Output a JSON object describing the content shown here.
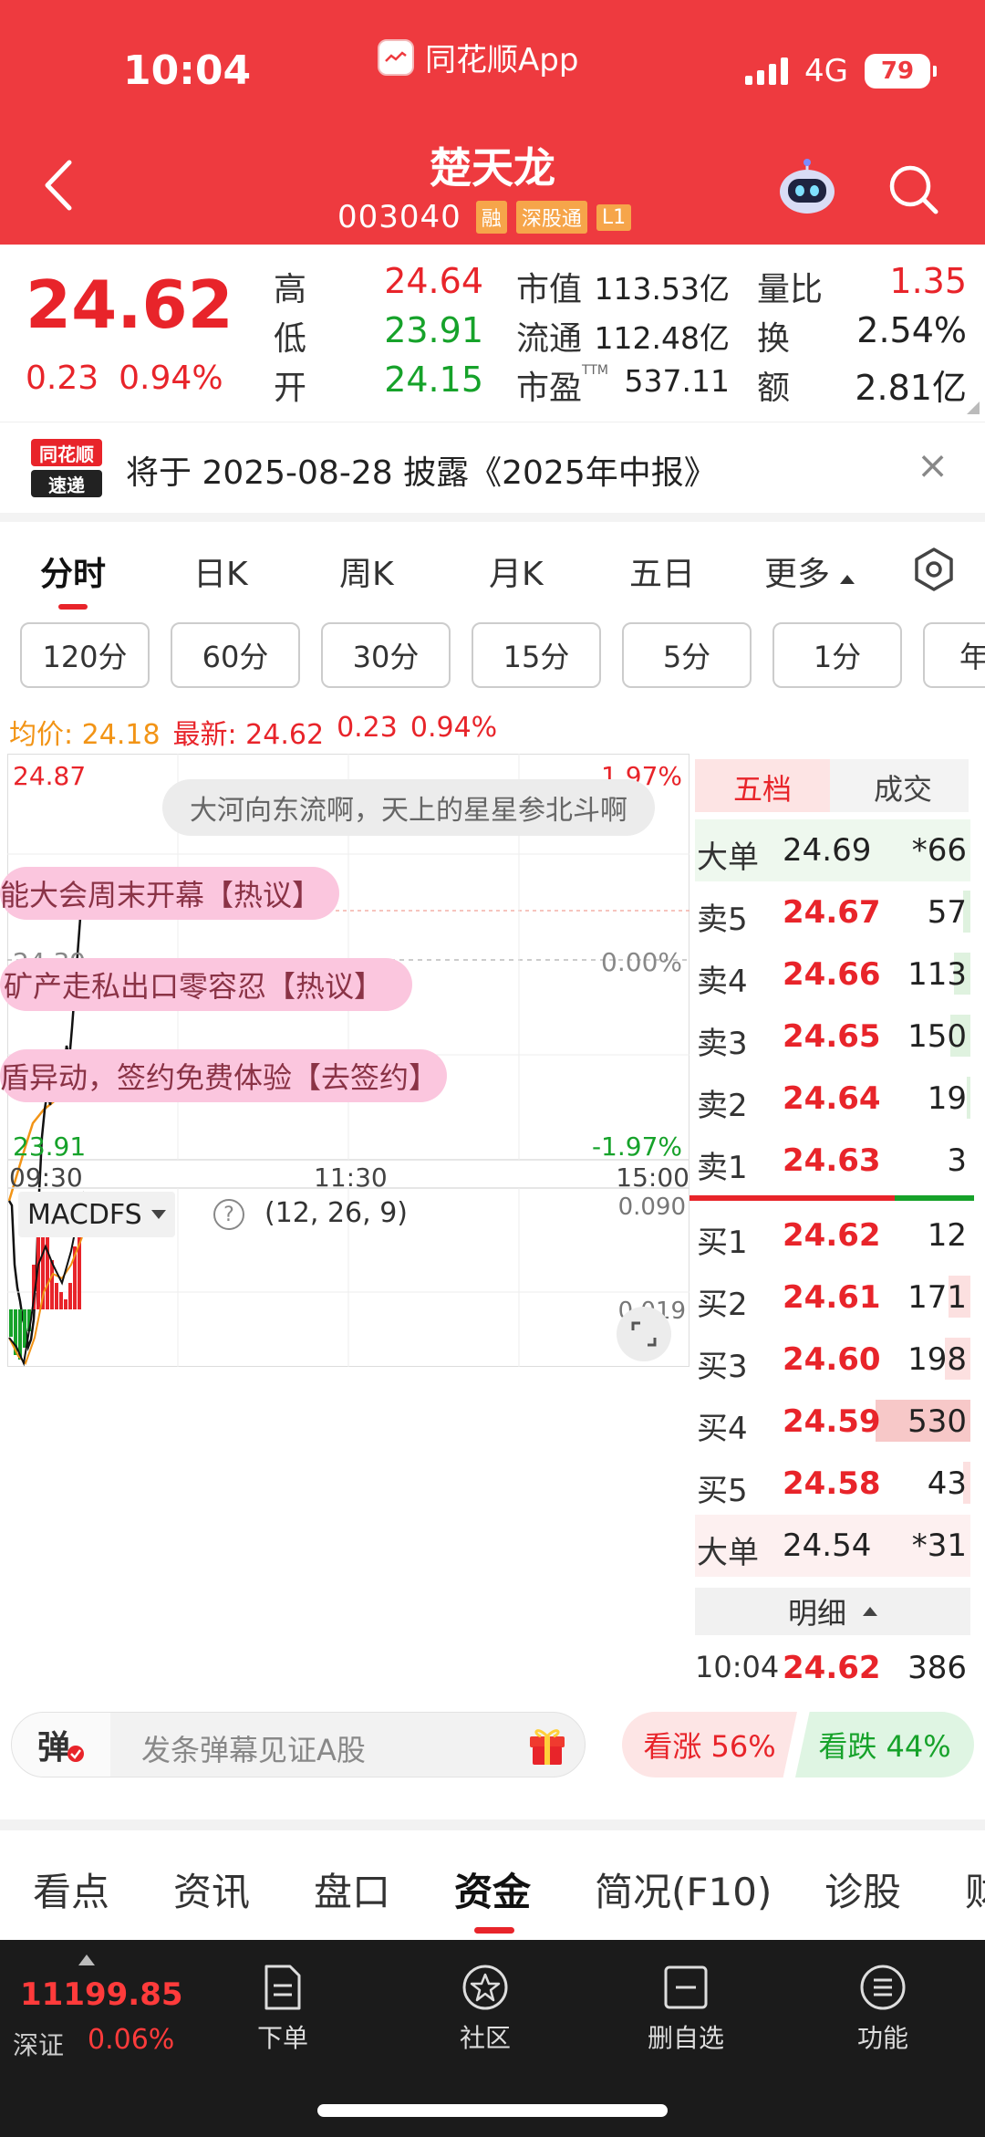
{
  "status_bar": {
    "time": "10:04",
    "app_name": "同花顺App",
    "network": "4G",
    "battery": "79"
  },
  "stock": {
    "name": "楚天龙",
    "code": "003040",
    "tags": [
      "融",
      "深股通",
      "L1"
    ]
  },
  "quote": {
    "price": "24.62",
    "change": "0.23",
    "change_pct": "0.94%",
    "high_label": "高",
    "high": "24.64",
    "low_label": "低",
    "low": "23.91",
    "open_label": "开",
    "open": "24.15",
    "mktcap_label": "市值",
    "mktcap": "113.53亿",
    "float_label": "流通",
    "float": "112.48亿",
    "pe_label": "市盈",
    "pe_sup": "TTM",
    "pe": "537.11",
    "volratio_label": "量比",
    "volratio": "1.35",
    "turnover_label": "换",
    "turnover": "2.54%",
    "amount_label": "额",
    "amount": "2.81亿"
  },
  "notice": {
    "logo_line1": "同花顺",
    "logo_line2": "速递",
    "text": "将于 2025-08-28 披露《2025年中报》",
    "close": "×"
  },
  "tabs": [
    "分时",
    "日K",
    "周K",
    "月K",
    "五日",
    "更多"
  ],
  "interval_pills": [
    "120分",
    "60分",
    "30分",
    "15分",
    "5分",
    "1分",
    "年"
  ],
  "avg_line": {
    "avg_label": "均价: 24.18",
    "latest_label": "最新: 24.62",
    "change": "0.23",
    "pct": "0.94%"
  },
  "chart": {
    "y_high": "24.87",
    "y_high_pct": "1.97%",
    "y_mid": "24.39",
    "y_mid_pct": "0.00%",
    "y_low": "23.91",
    "y_low_pct": "-1.97%",
    "x_start": "09:30",
    "x_mid": "11:30",
    "x_end": "15:00",
    "danmaku_top": "大河向东流啊，天上的星星参北斗啊",
    "danmaku": [
      "能大会周末开幕【热议】",
      "矿产走私出口零容忍【热议】",
      "盾异动，签约免费体验【去签约】"
    ],
    "macd_label": "MACDFS",
    "macd_params": "(12, 26, 9)",
    "macd_top": "0.090",
    "macd_mid": "0.019",
    "colors": {
      "up": "#e8242a",
      "down": "#16a22a",
      "avg": "#f29416",
      "price": "#111111"
    }
  },
  "order_book": {
    "tab_five": "五档",
    "tab_trades": "成交",
    "big_sell": {
      "label": "大单",
      "price": "24.69",
      "vol": "*66"
    },
    "asks": [
      {
        "label": "卖5",
        "price": "24.67",
        "vol": "57"
      },
      {
        "label": "卖4",
        "price": "24.66",
        "vol": "113"
      },
      {
        "label": "卖3",
        "price": "24.65",
        "vol": "150"
      },
      {
        "label": "卖2",
        "price": "24.64",
        "vol": "19"
      },
      {
        "label": "卖1",
        "price": "24.63",
        "vol": "3"
      }
    ],
    "bids": [
      {
        "label": "买1",
        "price": "24.62",
        "vol": "12"
      },
      {
        "label": "买2",
        "price": "24.61",
        "vol": "171"
      },
      {
        "label": "买3",
        "price": "24.60",
        "vol": "198"
      },
      {
        "label": "买4",
        "price": "24.59",
        "vol": "530"
      },
      {
        "label": "买5",
        "price": "24.58",
        "vol": "43"
      }
    ],
    "big_buy": {
      "label": "大单",
      "price": "24.54",
      "vol": "*31"
    },
    "detail_label": "明细",
    "last_trade": {
      "time": "10:04",
      "price": "24.62",
      "vol": "386"
    }
  },
  "danmu_input": {
    "icon_text": "弹",
    "placeholder": "发条弹幕见证A股"
  },
  "vote": {
    "up": "看涨 56%",
    "down": "看跌 44%"
  },
  "sub_tabs": [
    "看点",
    "资讯",
    "盘口",
    "资金",
    "简况(F10)",
    "诊股",
    "财"
  ],
  "bottom_bar": {
    "index_value": "11199.85",
    "index_name": "深证",
    "index_pct": "0.06%",
    "nav": [
      "下单",
      "社区",
      "删自选",
      "功能"
    ]
  }
}
